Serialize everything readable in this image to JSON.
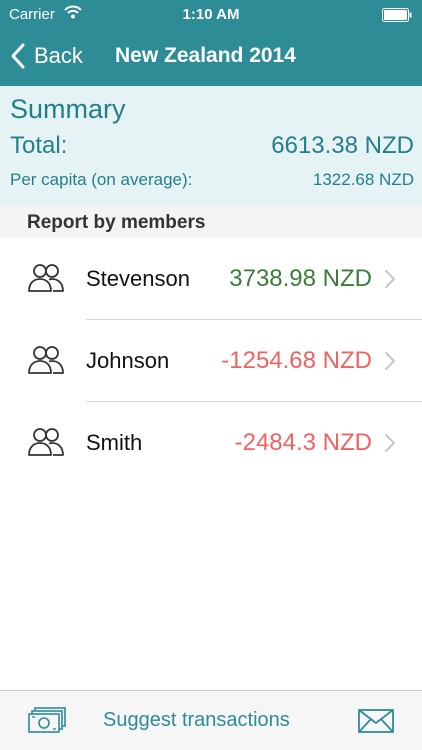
{
  "status_bar": {
    "carrier": "Carrier",
    "time": "1:10 AM",
    "wifi_icon": "wifi-icon",
    "battery_icon": "battery-icon"
  },
  "nav": {
    "back_label": "Back",
    "title": "New Zealand 2014",
    "back_icon": "chevron-left-icon"
  },
  "summary": {
    "heading": "Summary",
    "total_label": "Total:",
    "total_value": "6613.38 NZD",
    "per_capita_label": "Per capita (on average):",
    "per_capita_value": "1322.68 NZD"
  },
  "report": {
    "title": "Report by members",
    "members": [
      {
        "name": "Stevenson",
        "balance": "3738.98 NZD",
        "status": "positive"
      },
      {
        "name": "Johnson",
        "balance": "-1254.68 NZD",
        "status": "negative"
      },
      {
        "name": "Smith",
        "balance": "-2484.3 NZD",
        "status": "negative"
      }
    ]
  },
  "toolbar": {
    "suggest_label": "Suggest transactions",
    "left_icon": "money-icon",
    "right_icon": "mail-icon"
  },
  "colors": {
    "accent": "#2e8c96",
    "summary_bg": "#e6f3f4",
    "positive": "#3a7d3a",
    "negative": "#ef6263"
  }
}
